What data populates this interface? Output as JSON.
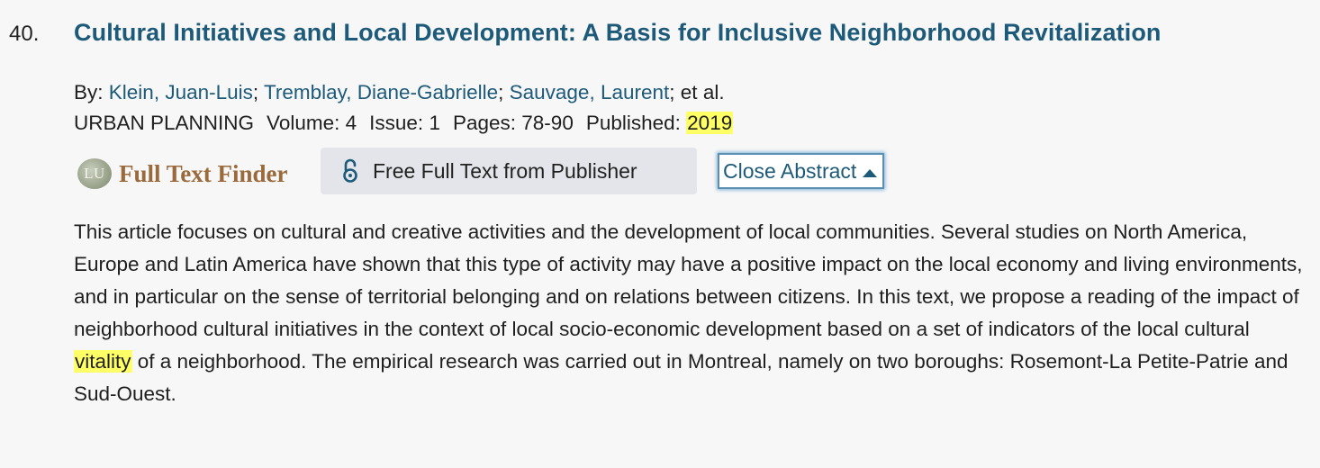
{
  "record": {
    "number": "40.",
    "title": "Cultural Initiatives and Local Development: A Basis for Inclusive Neighborhood Revitalization",
    "by_label": "By:",
    "authors": [
      "Klein, Juan-Luis",
      "Tremblay, Diane-Gabrielle",
      "Sauvage, Laurent"
    ],
    "author_sep": ";",
    "et_al": "et al.",
    "journal": "URBAN PLANNING",
    "volume_label": "Volume:",
    "volume": "4",
    "issue_label": "Issue:",
    "issue": "1",
    "pages_label": "Pages:",
    "pages": "78-90",
    "published_label": "Published:",
    "published_year": "2019"
  },
  "buttons": {
    "full_text_finder_logo": "LU",
    "full_text_finder": "Full Text Finder",
    "free_full_text": "Free Full Text from Publisher",
    "close_abstract": "Close Abstract"
  },
  "abstract": {
    "before_highlight": "This article focuses on cultural and creative activities and the development of local communities. Several studies on North America, Europe and Latin America have shown that this type of activity may have a positive impact on the local economy and living environments, and in particular on the sense of territorial belonging and on relations between citizens. In this text, we propose a reading of the impact of neighborhood cultural initiatives in the context of local socio-economic development based on a set of indicators of the local cultural ",
    "highlight": "vitality",
    "after_highlight": " of a neighborhood. The empirical research was carried out in Montreal, namely on two boroughs: Rosemont-La Petite-Patrie and Sud-Ouest."
  },
  "colors": {
    "link": "#1d5a7a",
    "highlight": "#ffff66",
    "background": "#f7f7f7",
    "button_bg": "#e3e5ea",
    "full_text_finder": "#9a6a3c"
  },
  "icons": {
    "open_access": "open-access-icon",
    "caret_up": "caret-up-icon"
  }
}
